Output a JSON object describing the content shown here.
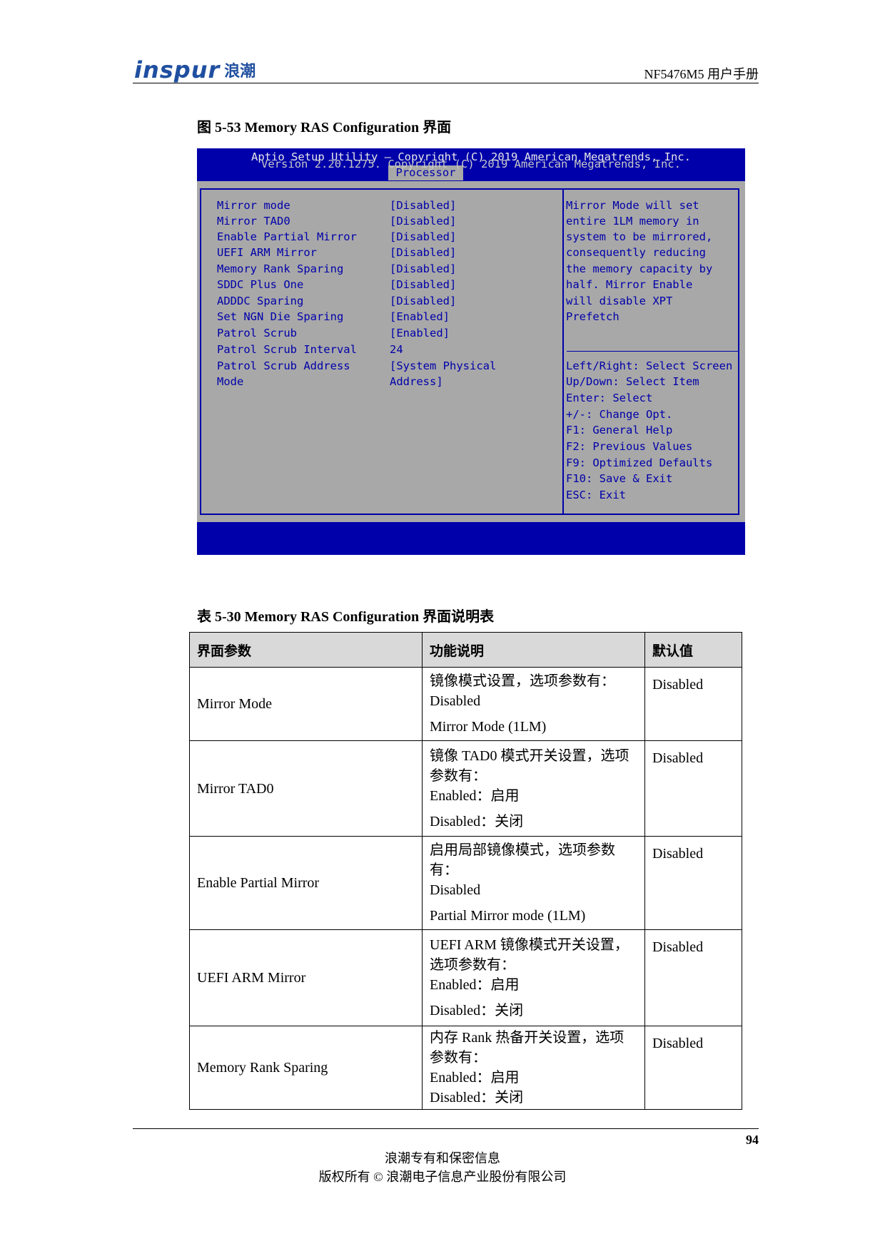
{
  "header": {
    "logo_text": "inspur",
    "logo_cn": "浪潮",
    "doc_title": "NF5476M5 用户手册"
  },
  "figure": {
    "caption": "图 5-53 Memory RAS Configuration 界面"
  },
  "bios": {
    "title": "Aptio Setup Utility – Copyright (C) 2019 American Megatrends, Inc.",
    "active_tab": "Processor",
    "settings": [
      {
        "label": "Mirror mode",
        "value": "[Disabled]"
      },
      {
        "label": "Mirror TAD0",
        "value": "[Disabled]"
      },
      {
        "label": "Enable Partial Mirror",
        "value": "[Disabled]"
      },
      {
        "label": "UEFI ARM Mirror",
        "value": "[Disabled]"
      },
      {
        "label": "Memory Rank Sparing",
        "value": "[Disabled]"
      },
      {
        "label": "SDDC Plus One",
        "value": "[Disabled]"
      },
      {
        "label": "ADDDC Sparing",
        "value": "[Disabled]"
      },
      {
        "label": "Set NGN Die Sparing",
        "value": "[Enabled]"
      },
      {
        "label": "Patrol Scrub",
        "value": "[Enabled]"
      },
      {
        "label": "Patrol Scrub Interval",
        "value": "24"
      },
      {
        "label": "Patrol Scrub Address",
        "value": "[System Physical"
      },
      {
        "label": "Mode",
        "value": "Address]"
      }
    ],
    "help_text": [
      "Mirror Mode will set",
      "entire 1LM memory in",
      "system to be mirrored,",
      "consequently reducing",
      "the memory capacity by",
      "half. Mirror Enable",
      "will disable XPT",
      "Prefetch"
    ],
    "key_help": [
      "Left/Right: Select Screen",
      "Up/Down: Select Item",
      "Enter: Select",
      "+/-: Change Opt.",
      "F1: General Help",
      "F2: Previous Values",
      "F9: Optimized Defaults",
      "F10: Save & Exit",
      "ESC: Exit"
    ],
    "footer": "Version 2.20.1275. Copyright (C) 2019 American Megatrends, Inc."
  },
  "table": {
    "caption": "表 5-30 Memory RAS Configuration 界面说明表",
    "headers": [
      "界面参数",
      "功能说明",
      "默认值"
    ],
    "rows": [
      {
        "param": "Mirror Mode",
        "func": [
          "镜像模式设置，选项参数有：",
          "Disabled",
          "Mirror Mode (1LM)"
        ],
        "default": "Disabled"
      },
      {
        "param": "Mirror TAD0",
        "func": [
          "镜像 TAD0 模式开关设置，选项参数有：",
          "Enabled：启用",
          "Disabled：关闭"
        ],
        "default": "Disabled"
      },
      {
        "param": "Enable Partial Mirror",
        "func": [
          "启用局部镜像模式，选项参数有：",
          "Disabled",
          "Partial Mirror mode (1LM)"
        ],
        "default": "Disabled"
      },
      {
        "param": "UEFI ARM Mirror",
        "func": [
          "UEFI ARM 镜像模式开关设置，选项参数有：",
          "Enabled：启用",
          "Disabled：关闭"
        ],
        "default": "Disabled"
      },
      {
        "param": "Memory Rank Sparing",
        "func": [
          "内存 Rank 热备开关设置，选项参数有：",
          "Enabled：启用",
          "Disabled：关闭"
        ],
        "default": "Disabled"
      }
    ]
  },
  "footer": {
    "page_number": "94",
    "line1": "浪潮专有和保密信息",
    "line2": "版权所有 © 浪潮电子信息产业股份有限公司"
  }
}
